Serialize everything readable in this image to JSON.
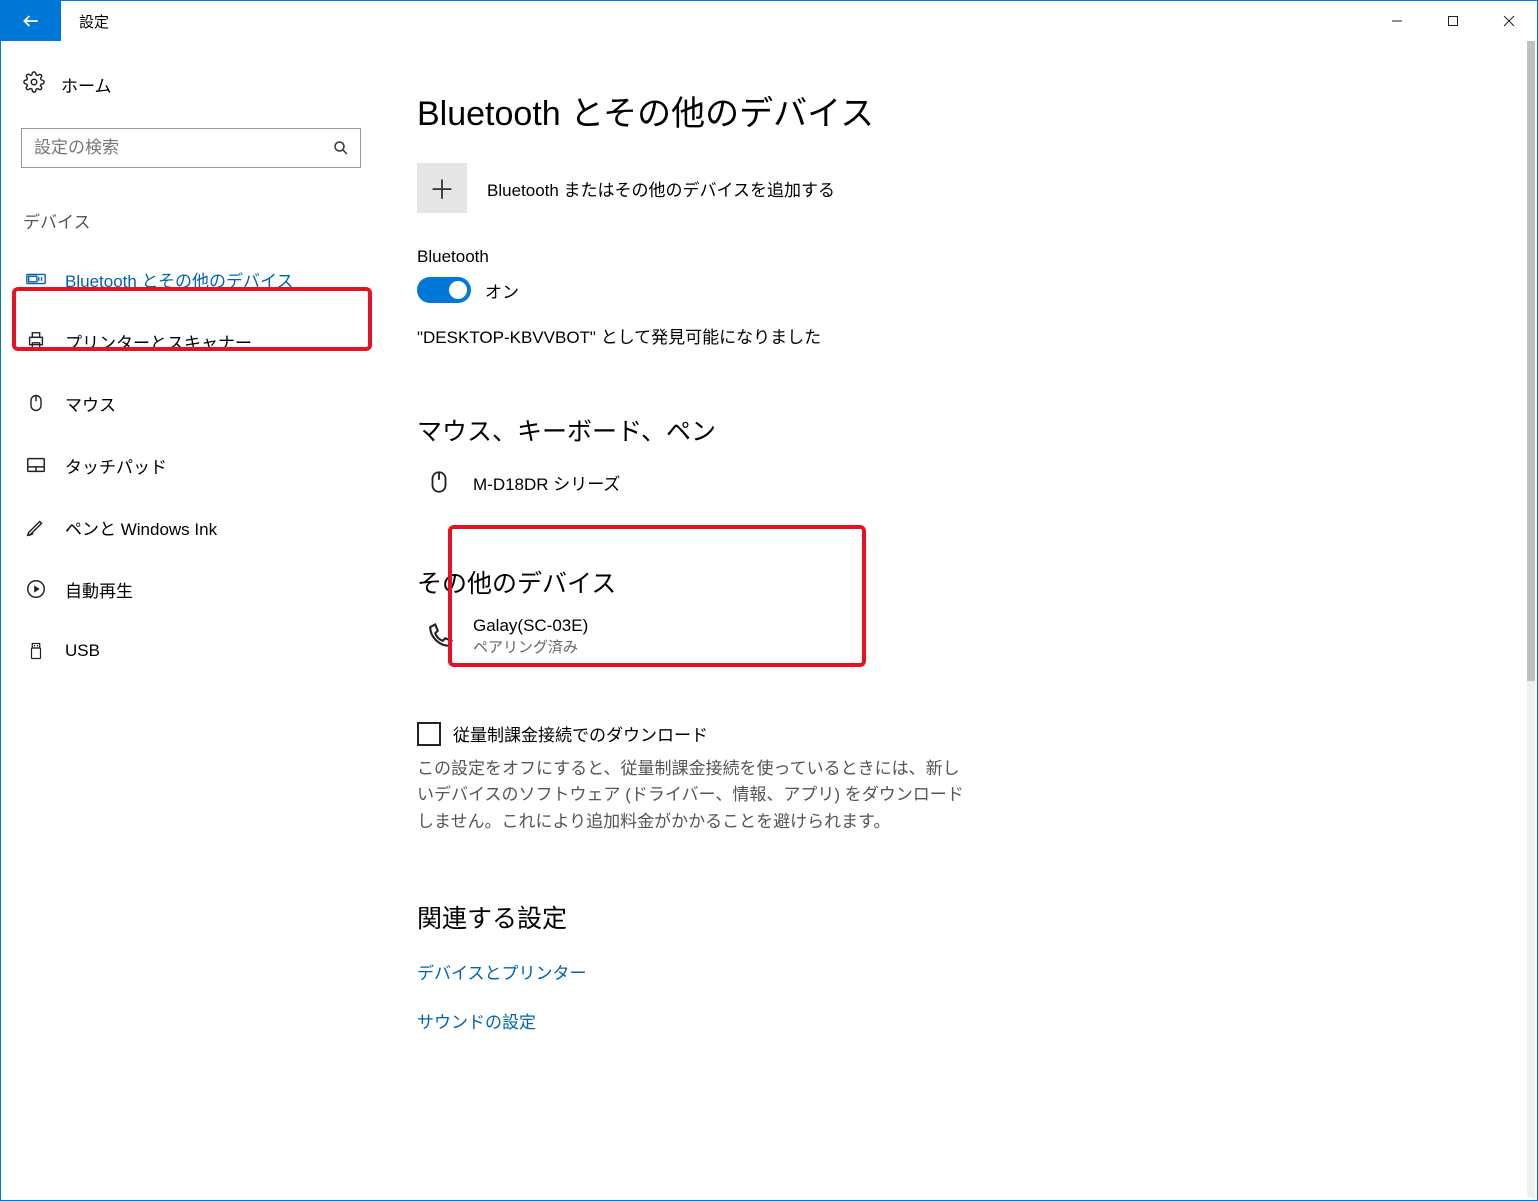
{
  "title": "設定",
  "sidebar": {
    "home": "ホーム",
    "search_placeholder": "設定の検索",
    "section": "デバイス",
    "items": [
      {
        "label": "Bluetooth とその他のデバイス",
        "active": true
      },
      {
        "label": "プリンターとスキャナー"
      },
      {
        "label": "マウス"
      },
      {
        "label": "タッチパッド"
      },
      {
        "label": "ペンと Windows Ink"
      },
      {
        "label": "自動再生"
      },
      {
        "label": "USB"
      }
    ]
  },
  "main": {
    "page_title": "Bluetooth とその他のデバイス",
    "add_device": "Bluetooth またはその他のデバイスを追加する",
    "bluetooth": {
      "title": "Bluetooth",
      "state": "オン",
      "discoverable": "\"DESKTOP-KBVVBOT\" として発見可能になりました"
    },
    "input_devices": {
      "title": "マウス、キーボード、ペン",
      "items": [
        {
          "name": "M-D18DR シリーズ"
        }
      ]
    },
    "other_devices": {
      "title": "その他のデバイス",
      "items": [
        {
          "name": "Galay(SC-03E)",
          "status": "ペアリング済み"
        }
      ]
    },
    "metered": {
      "label": "従量制課金接続でのダウンロード",
      "desc": "この設定をオフにすると、従量制課金接続を使っているときには、新しいデバイスのソフトウェア (ドライバー、情報、アプリ) をダウンロードしません。これにより追加料金がかかることを避けられます。"
    },
    "related": {
      "title": "関連する設定",
      "links": [
        "デバイスとプリンター",
        "サウンドの設定"
      ]
    }
  }
}
